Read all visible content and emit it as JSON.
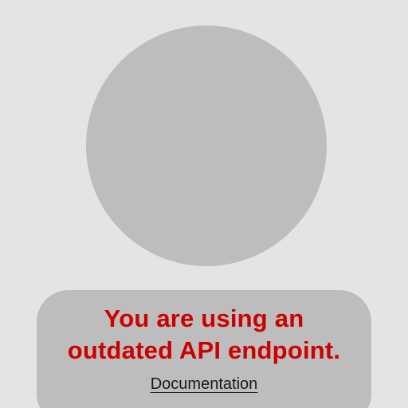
{
  "placeholder": {
    "background_color": "#e4e4e4",
    "avatar_color": "#bdbdbd",
    "avatar_icon": "user-silhouette-icon"
  },
  "message": {
    "line1": "You are using an",
    "line2": "outdated API endpoint.",
    "color": "#cc0000"
  },
  "link": {
    "label": "Documentation"
  }
}
